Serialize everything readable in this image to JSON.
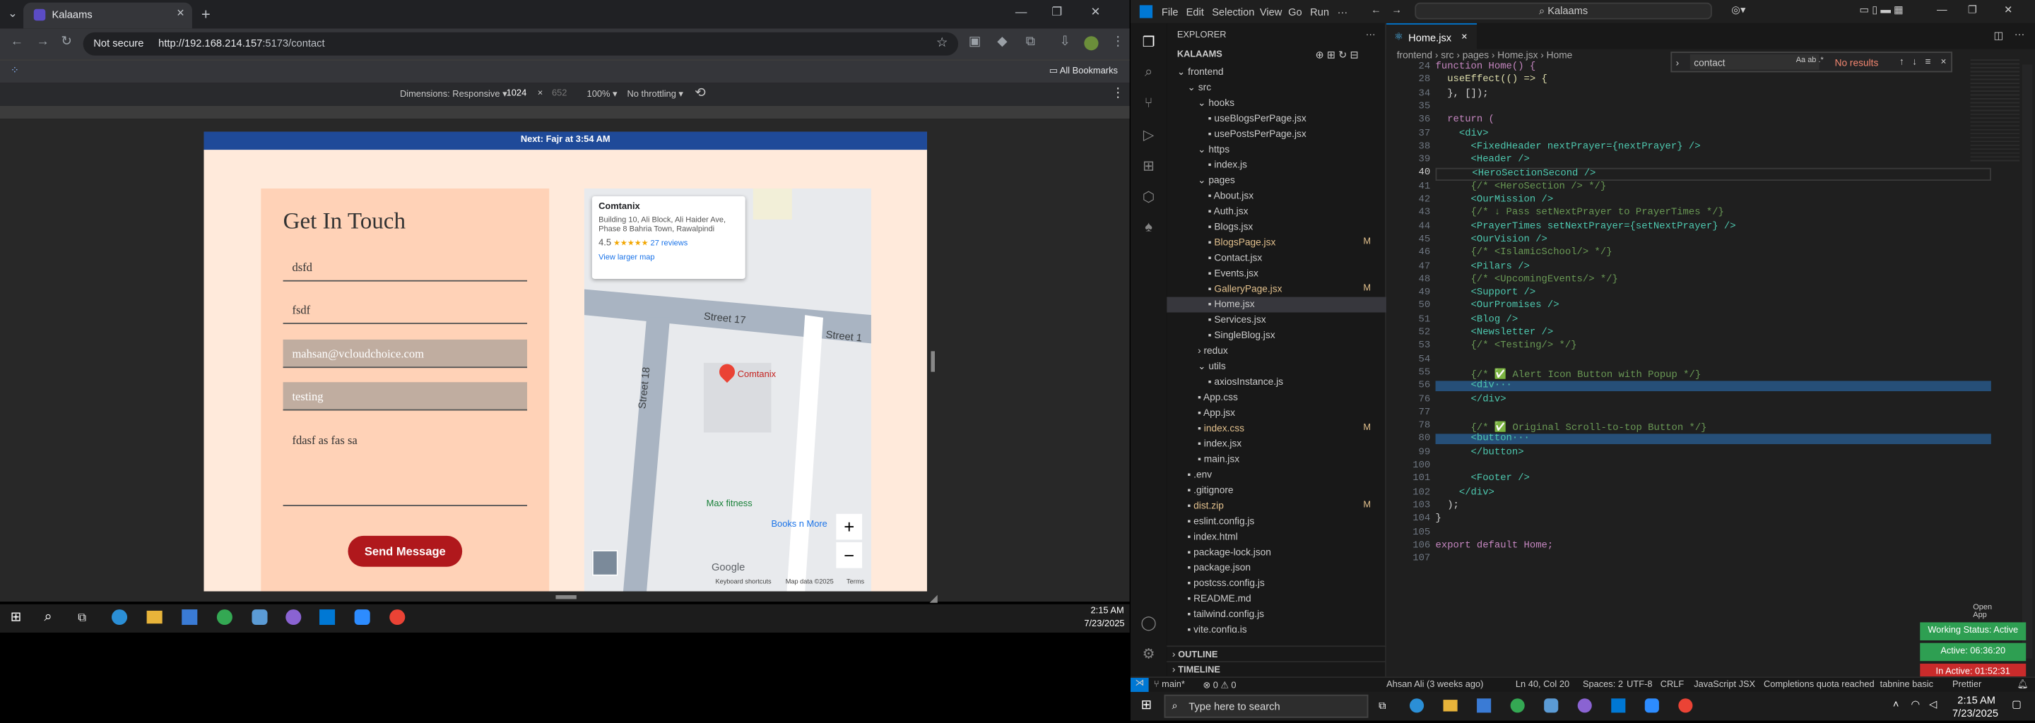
{
  "browser": {
    "tab_title": "Kalaams",
    "security": "Not secure",
    "url_host": "http://192.168.214.157",
    "url_rest": ":5173/contact",
    "all_bookmarks": "All Bookmarks",
    "devtools": {
      "dimensions": "Dimensions: Responsive ▾",
      "width": "1024",
      "height": "652",
      "zoom": "100% ▾",
      "throttle": "No throttling ▾"
    }
  },
  "site": {
    "prayer_bar": "Next: Fajr at 3:54 AM",
    "form": {
      "title": "Get In Touch",
      "name_value": "dsfd",
      "surname_value": "fsdf",
      "email_value": "mahsan@vcloudchoice.com",
      "subject_value": "testing",
      "message_value": "fdasf as fas sa",
      "send_label": "Send Message"
    },
    "map": {
      "place": "Comtanix",
      "address": "Building 10, Ali Block, Ali Haider Ave, Phase 8 Bahria Town, Rawalpindi",
      "rating": "4.5",
      "stars": "★★★★★",
      "reviews": "27 reviews",
      "larger_map": "View larger map",
      "street_17": "Street 17",
      "street_18": "Street 18",
      "street_1": "Street 1",
      "pin_label": "Comtanix",
      "poi_1": "Max fitness",
      "poi_2": "Books n More",
      "google": "Google",
      "kbd": "Keyboard shortcuts",
      "mapdata": "Map data ©2025",
      "terms": "Terms",
      "zoom_in": "+",
      "zoom_out": "−"
    }
  },
  "vscode": {
    "menu": [
      "File",
      "Edit",
      "Selection",
      "View",
      "Go",
      "Run",
      "···"
    ],
    "search_label": "Kalaams",
    "explorer_title": "EXPLORER",
    "explorer_more": "···",
    "project": "KALAAMS",
    "tree": [
      {
        "label": "frontend",
        "indent": 1,
        "kind": "folder-open",
        "mod": ""
      },
      {
        "label": "src",
        "indent": 2,
        "kind": "folder-open",
        "mod": ""
      },
      {
        "label": "hooks",
        "indent": 3,
        "kind": "folder-open",
        "mod": ""
      },
      {
        "label": "useBlogsPerPage.jsx",
        "indent": 4,
        "kind": "file",
        "mod": ""
      },
      {
        "label": "usePostsPerPage.jsx",
        "indent": 4,
        "kind": "file",
        "mod": ""
      },
      {
        "label": "https",
        "indent": 3,
        "kind": "folder-open",
        "mod": ""
      },
      {
        "label": "index.js",
        "indent": 4,
        "kind": "file",
        "mod": ""
      },
      {
        "label": "pages",
        "indent": 3,
        "kind": "folder-open",
        "mod": ""
      },
      {
        "label": "About.jsx",
        "indent": 4,
        "kind": "file",
        "mod": ""
      },
      {
        "label": "Auth.jsx",
        "indent": 4,
        "kind": "file",
        "mod": ""
      },
      {
        "label": "Blogs.jsx",
        "indent": 4,
        "kind": "file",
        "mod": ""
      },
      {
        "label": "BlogsPage.jsx",
        "indent": 4,
        "kind": "file",
        "mod": "M"
      },
      {
        "label": "Contact.jsx",
        "indent": 4,
        "kind": "file",
        "mod": ""
      },
      {
        "label": "Events.jsx",
        "indent": 4,
        "kind": "file",
        "mod": ""
      },
      {
        "label": "GalleryPage.jsx",
        "indent": 4,
        "kind": "file",
        "mod": "M"
      },
      {
        "label": "Home.jsx",
        "indent": 4,
        "kind": "file",
        "mod": ""
      },
      {
        "label": "Services.jsx",
        "indent": 4,
        "kind": "file",
        "mod": ""
      },
      {
        "label": "SingleBlog.jsx",
        "indent": 4,
        "kind": "file",
        "mod": ""
      },
      {
        "label": "redux",
        "indent": 3,
        "kind": "folder",
        "mod": ""
      },
      {
        "label": "utils",
        "indent": 3,
        "kind": "folder-open",
        "mod": ""
      },
      {
        "label": "axiosInstance.js",
        "indent": 4,
        "kind": "file",
        "mod": ""
      },
      {
        "label": "App.css",
        "indent": 3,
        "kind": "file",
        "mod": ""
      },
      {
        "label": "App.jsx",
        "indent": 3,
        "kind": "file",
        "mod": ""
      },
      {
        "label": "index.css",
        "indent": 3,
        "kind": "file",
        "mod": "M"
      },
      {
        "label": "index.jsx",
        "indent": 3,
        "kind": "file",
        "mod": ""
      },
      {
        "label": "main.jsx",
        "indent": 3,
        "kind": "file",
        "mod": ""
      },
      {
        "label": ".env",
        "indent": 2,
        "kind": "file",
        "mod": ""
      },
      {
        "label": ".gitignore",
        "indent": 2,
        "kind": "file",
        "mod": ""
      },
      {
        "label": "dist.zip",
        "indent": 2,
        "kind": "file",
        "mod": "M"
      },
      {
        "label": "eslint.config.js",
        "indent": 2,
        "kind": "file",
        "mod": ""
      },
      {
        "label": "index.html",
        "indent": 2,
        "kind": "file",
        "mod": ""
      },
      {
        "label": "package-lock.json",
        "indent": 2,
        "kind": "file",
        "mod": ""
      },
      {
        "label": "package.json",
        "indent": 2,
        "kind": "file",
        "mod": ""
      },
      {
        "label": "postcss.config.js",
        "indent": 2,
        "kind": "file",
        "mod": ""
      },
      {
        "label": "README.md",
        "indent": 2,
        "kind": "file",
        "mod": ""
      },
      {
        "label": "tailwind.config.js",
        "indent": 2,
        "kind": "file",
        "mod": ""
      },
      {
        "label": "vite.config.js",
        "indent": 2,
        "kind": "file",
        "mod": ""
      }
    ],
    "outline": "OUTLINE",
    "timeline": "TIMELINE",
    "editor_tab": "Home.jsx",
    "breadcrumb": [
      "frontend",
      "src",
      "pages",
      "Home.jsx",
      "Home"
    ],
    "find": {
      "value": "contact",
      "result": "No results"
    },
    "code": [
      {
        "n": "24",
        "t": "function Home() {"
      },
      {
        "n": "28",
        "t": "  useEffect(() => {"
      },
      {
        "n": "34",
        "t": "  }, []);"
      },
      {
        "n": "35",
        "t": ""
      },
      {
        "n": "36",
        "t": "  return ("
      },
      {
        "n": "37",
        "t": "    <div>"
      },
      {
        "n": "38",
        "t": "      <FixedHeader nextPrayer={nextPrayer} />"
      },
      {
        "n": "39",
        "t": "      <Header />"
      },
      {
        "n": "40",
        "t": "      <HeroSectionSecond />"
      },
      {
        "n": "41",
        "t": "      {/* <HeroSection /> */}"
      },
      {
        "n": "42",
        "t": "      <OurMission />"
      },
      {
        "n": "43",
        "t": "      {/* ↓ Pass setNextPrayer to PrayerTimes */}"
      },
      {
        "n": "44",
        "t": "      <PrayerTimes setNextPrayer={setNextPrayer} />"
      },
      {
        "n": "45",
        "t": "      <OurVision />"
      },
      {
        "n": "46",
        "t": "      {/* <IslamicSchool/> */}"
      },
      {
        "n": "47",
        "t": "      <Pilars />"
      },
      {
        "n": "48",
        "t": "      {/* <UpcomingEvents/> */}"
      },
      {
        "n": "49",
        "t": "      <Support />"
      },
      {
        "n": "50",
        "t": "      <OurPromises />"
      },
      {
        "n": "51",
        "t": "      <Blog />"
      },
      {
        "n": "52",
        "t": "      <Newsletter />"
      },
      {
        "n": "53",
        "t": "      {/* <Testing/> */}"
      },
      {
        "n": "54",
        "t": ""
      },
      {
        "n": "55",
        "t": "      {/* ✅ Alert Icon Button with Popup */}"
      },
      {
        "n": "56",
        "t": "      <div···"
      },
      {
        "n": "76",
        "t": "      </div>"
      },
      {
        "n": "77",
        "t": ""
      },
      {
        "n": "78",
        "t": "      {/* ✅ Original Scroll-to-top Button */}"
      },
      {
        "n": "80",
        "t": "      <button···"
      },
      {
        "n": "99",
        "t": "      </button>"
      },
      {
        "n": "100",
        "t": ""
      },
      {
        "n": "101",
        "t": "      <Footer />"
      },
      {
        "n": "102",
        "t": "    </div>"
      },
      {
        "n": "103",
        "t": "  );"
      },
      {
        "n": "104",
        "t": "}"
      },
      {
        "n": "105",
        "t": ""
      },
      {
        "n": "106",
        "t": "export default Home;"
      },
      {
        "n": "107",
        "t": ""
      }
    ],
    "status": {
      "branch": "main*",
      "problems": "0 ⚠ 0",
      "blame": "Ahsan Ali (3 weeks ago)",
      "position": "Ln 40, Col 20",
      "spaces": "Spaces: 2",
      "encoding": "UTF-8",
      "eol": "CRLF",
      "language": "JavaScript JSX",
      "completions": "Completions quota reached",
      "tabnine": "tabnine basic",
      "prettier": "Prettier"
    },
    "open_app": "Open App",
    "working_status": "Working Status: Active",
    "active_time": "Active: 06:36:20",
    "inactive_time": "In Active: 01:52:31"
  },
  "taskbars": {
    "left_time": "2:15 AM",
    "left_date": "7/23/2025",
    "right_search": "Type here to search",
    "right_time": "2:15 AM",
    "right_date": "7/23/2025"
  },
  "colors": {
    "prayer_bar": "#1f4a99",
    "send_button": "#b0181c",
    "form_card": "#ffd2b7",
    "vscode_accent": "#0078d4",
    "working_status": "#2e9f52",
    "inactive": "#c92b2b"
  }
}
